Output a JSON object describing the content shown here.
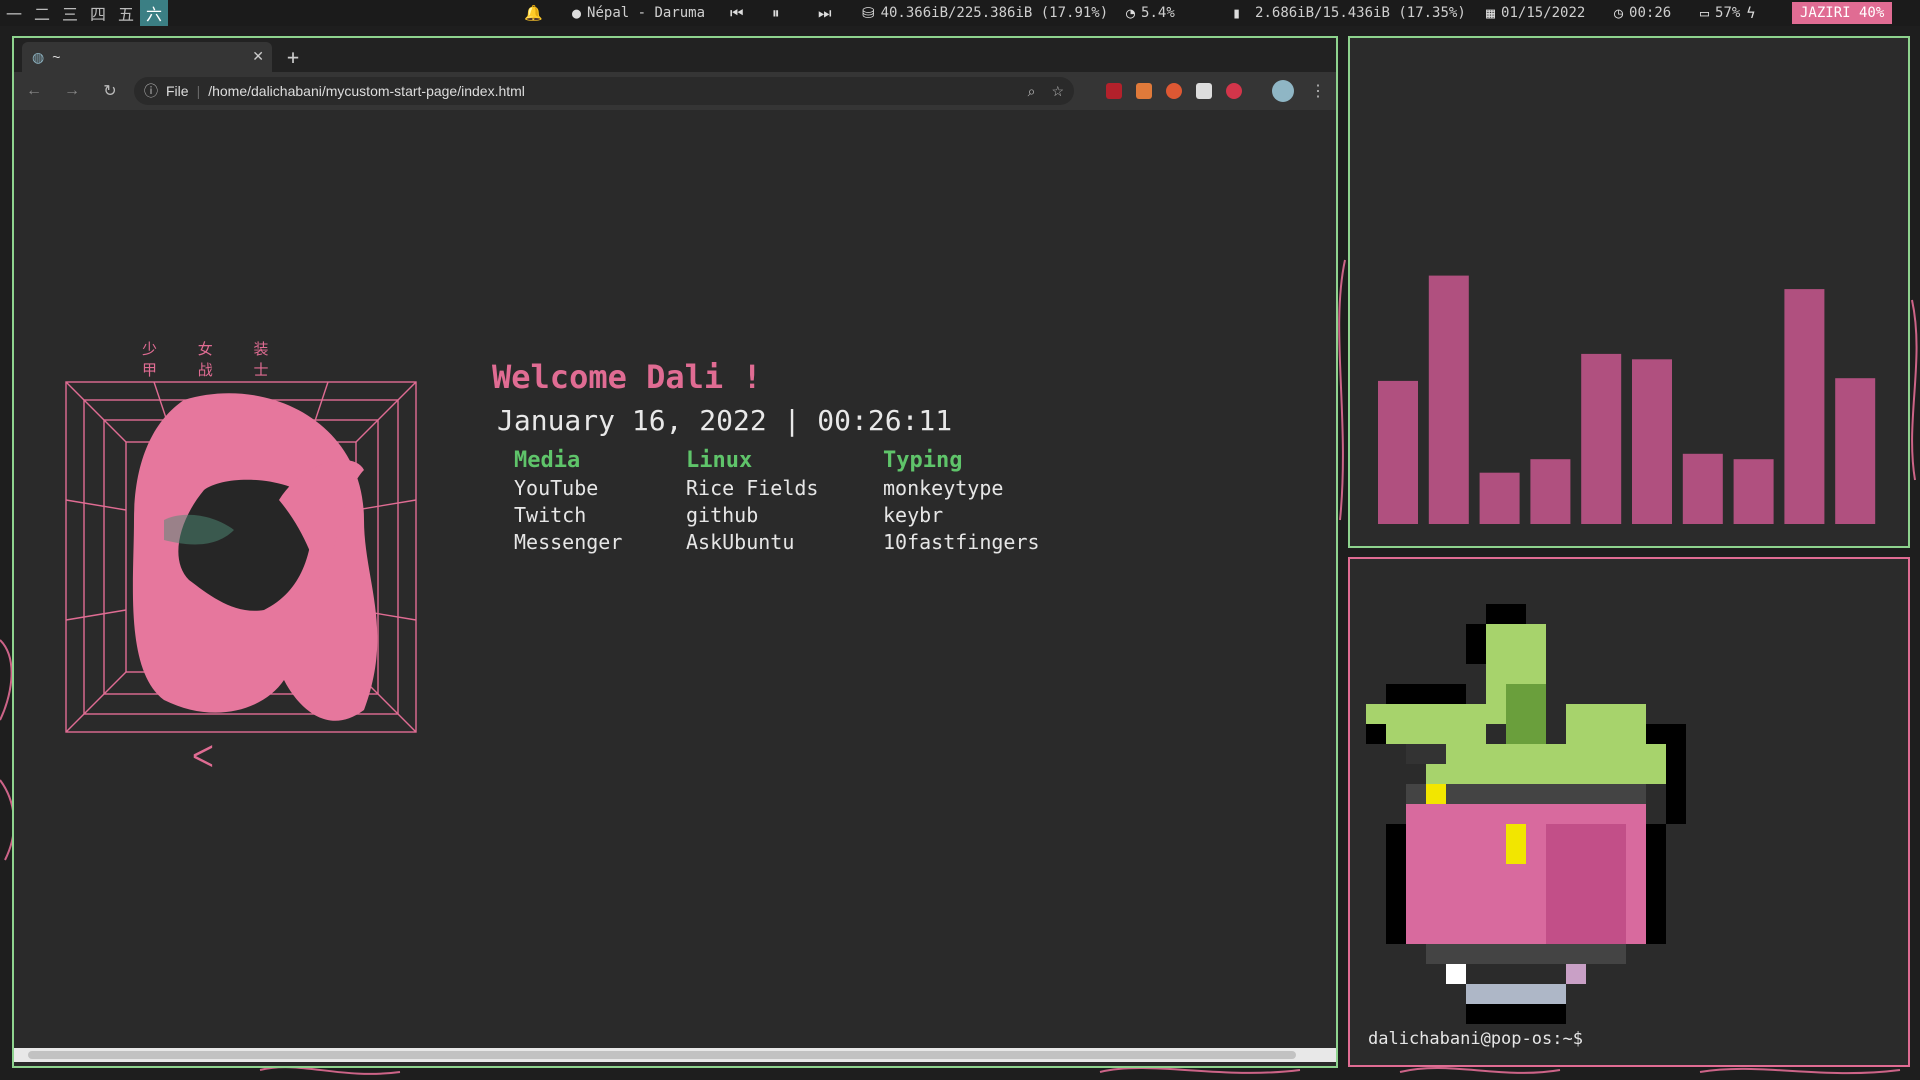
{
  "topbar": {
    "workspaces": [
      "一",
      "二",
      "三",
      "四",
      "五",
      "六"
    ],
    "active_workspace": 5,
    "now_playing": "Népal - Daruma",
    "disk": "40.366iB/225.386iB (17.91%)",
    "cpu": "5.4%",
    "memory": "2.686iB/15.436iB (17.35%)",
    "date": "01/15/2022",
    "time": "00:26",
    "battery": "57%",
    "keyboard": "JAZIRI 40%",
    "icons": {
      "bell": "bell-icon",
      "spotify": "spotify-icon",
      "prev": "previous-track-icon",
      "pause": "pause-icon",
      "next": "next-track-icon",
      "disk": "disk-icon",
      "cpu": "speedometer-icon",
      "memory": "memory-icon",
      "calendar": "calendar-icon",
      "clock": "clock-icon",
      "battery": "battery-icon",
      "charging": "bolt-icon"
    }
  },
  "browser": {
    "tab_title": "~",
    "url_scheme_label": "File",
    "url": "/home/dalichabani/mycustom-start-page/index.html"
  },
  "startpage": {
    "cjk_title": "少 女 装 甲 战 士",
    "welcome": "Welcome Dali !",
    "datetime": "January 16, 2022 | 00:26:11",
    "columns": [
      {
        "heading": "Media",
        "links": [
          "YouTube",
          "Twitch",
          "Messenger"
        ]
      },
      {
        "heading": "Linux",
        "links": [
          "Rice Fields",
          "github",
          "AskUbuntu"
        ]
      },
      {
        "heading": "Typing",
        "links": [
          "monkeytype",
          "keybr",
          "10fastfingers"
        ]
      }
    ]
  },
  "visualizer": {
    "bar_levels": [
      0.53,
      0.92,
      0.19,
      0.24,
      0.63,
      0.61,
      0.26,
      0.24,
      0.87,
      0.54
    ],
    "bar_color": "#b0507f"
  },
  "terminal": {
    "prompt": "dalichabani@pop-os:~$"
  },
  "colors": {
    "accent_pink": "#e06c93",
    "accent_green": "#5fc46a",
    "border_green": "#8ed38e"
  }
}
